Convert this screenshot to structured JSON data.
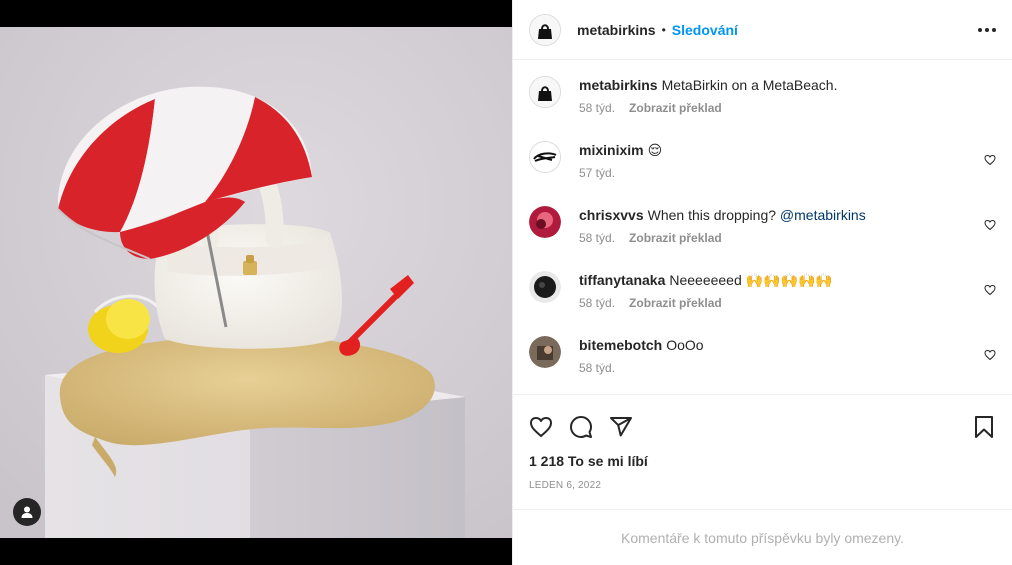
{
  "post": {
    "author": "metabirkins",
    "follow_label": "Sledování",
    "separator": "•",
    "caption": "MetaBirkin on a MetaBeach.",
    "caption_age": "58 týd.",
    "translate_label": "Zobrazit překlad",
    "likes": "1 218 To se mi líbí",
    "date": "LEDEN 6, 2022",
    "comments_limited": "Komentáře k tomuto příspěvku byly omezeny."
  },
  "comments": [
    {
      "user": "mixinixim",
      "text": "😌",
      "age": "57 týd.",
      "translate": ""
    },
    {
      "user": "chrisxvvs",
      "text": "When this dropping? ",
      "mention": "@metabirkins",
      "age": "58 týd.",
      "translate": "Zobrazit překlad"
    },
    {
      "user": "tiffanytanaka",
      "text": "Neeeeeeed 🙌🙌🙌🙌🙌",
      "age": "58 týd.",
      "translate": "Zobrazit překlad"
    },
    {
      "user": "bitemebotch",
      "text": "OoOo",
      "age": "58 týd.",
      "translate": ""
    }
  ],
  "icons": {
    "more": "more-options-icon",
    "like": "heart-icon",
    "comment": "comment-icon",
    "share": "share-icon",
    "save": "bookmark-icon",
    "tag": "user-tag-icon"
  },
  "colors": {
    "accent": "#0095f6",
    "mention": "#00376b",
    "muted": "#8e8e8e",
    "umbrella_red": "#d8232a"
  }
}
